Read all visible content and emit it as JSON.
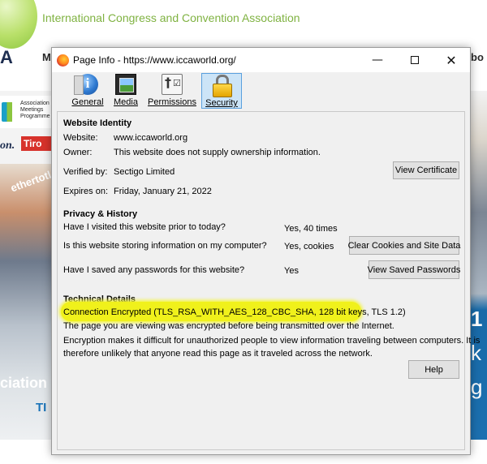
{
  "background": {
    "site_title": "International Congress and Convention Association",
    "logo_letter": "A",
    "nav_left": "M",
    "nav_right": "bo",
    "amp_label": "Association Meetings Programme",
    "on_text": "on.",
    "brand_text": "Tiro",
    "hashtag": "ethertotl",
    "assoc_text": "ciation",
    "ti_text": "TI",
    "right_1": "1",
    "right_2": "k",
    "right_3": "g"
  },
  "dialog": {
    "title": "Page Info - https://www.iccaworld.org/",
    "window_controls": {
      "minimize": "—",
      "close": "✕"
    },
    "tabs": [
      {
        "label": "General",
        "icon": "info-icon"
      },
      {
        "label": "Media",
        "icon": "media-icon"
      },
      {
        "label": "Permissions",
        "icon": "permissions-icon"
      },
      {
        "label": "Security",
        "icon": "lock-icon",
        "selected": true
      }
    ],
    "identity": {
      "heading": "Website Identity",
      "website_label": "Website:",
      "website_value": "www.iccaworld.org",
      "owner_label": "Owner:",
      "owner_value": "This website does not supply ownership information.",
      "verified_label": "Verified by:",
      "verified_value": "Sectigo Limited",
      "view_cert_button": "View Certificate",
      "expires_label": "Expires on:",
      "expires_value": "Friday, January 21, 2022"
    },
    "privacy": {
      "heading": "Privacy & History",
      "q1": "Have I visited this website prior to today?",
      "a1": "Yes, 40 times",
      "q2": "Is this website storing information on my computer?",
      "a2": "Yes, cookies",
      "clear_button": "Clear Cookies and Site Data",
      "q3": "Have I saved any passwords for this website?",
      "a3": "Yes",
      "view_passwords_button": "View Saved Passwords"
    },
    "technical": {
      "heading": "Technical Details",
      "connection": "Connection Encrypted (TLS_RSA_WITH_AES_128_CBC_SHA, 128 bit keys, TLS 1.2)",
      "line2": "The page you are viewing was encrypted before being transmitted over the Internet.",
      "line3": "Encryption makes it difficult for unauthorized people to view information traveling between computers. It is",
      "line4": "therefore unlikely that anyone read this page as it traveled across the network.",
      "highlight_color": "#f0f11b"
    },
    "help_button": "Help"
  }
}
